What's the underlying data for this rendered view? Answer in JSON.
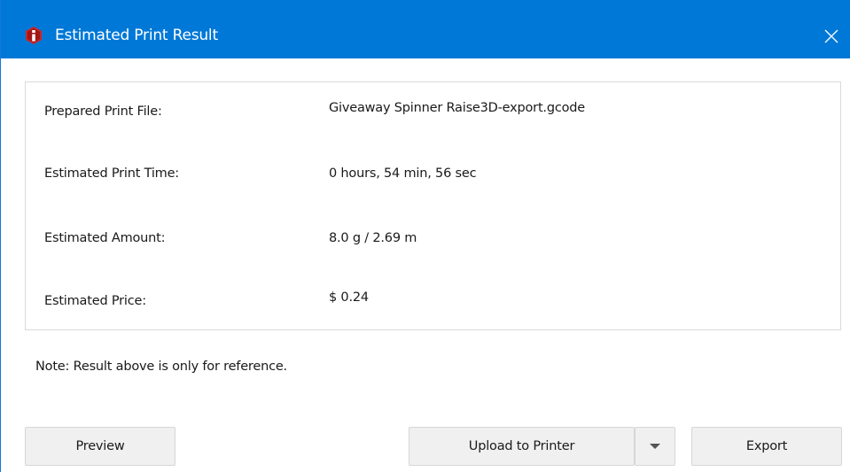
{
  "window": {
    "title": "Estimated Print Result",
    "accent_color": "#0078d7",
    "app_icon": "raise3d-logo-icon",
    "close_icon": "close-icon"
  },
  "info": {
    "rows": [
      {
        "label": "Prepared Print File:",
        "value": "Giveaway Spinner Raise3D-export.gcode"
      },
      {
        "label": "Estimated Print Time:",
        "value": "0 hours, 54 min, 56 sec"
      },
      {
        "label": "Estimated Amount:",
        "value": "8.0 g / 2.69 m"
      },
      {
        "label": "Estimated Price:",
        "value": "$ 0.24"
      }
    ]
  },
  "note": "Note: Result above is only for reference.",
  "buttons": {
    "preview": "Preview",
    "upload": "Upload to Printer",
    "dropdown_icon": "caret-down-icon",
    "export": "Export"
  }
}
